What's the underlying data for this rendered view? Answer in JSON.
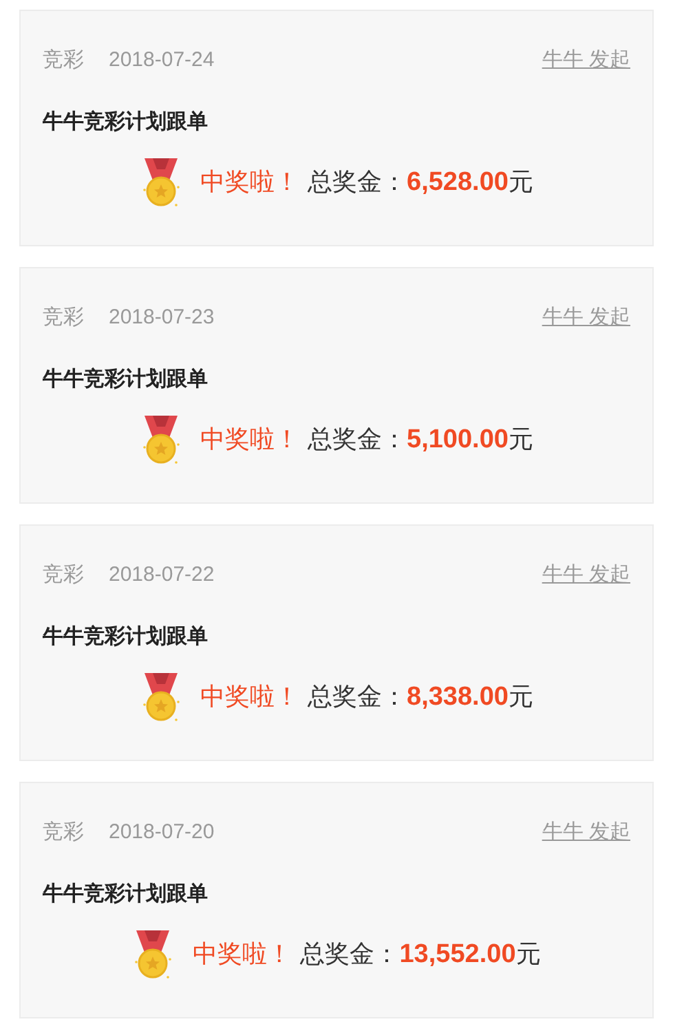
{
  "records": [
    {
      "category": "竞彩",
      "date": "2018-07-24",
      "initiator_link": "牛牛 发起",
      "title": "牛牛竞彩计划跟单",
      "win_label": "中奖啦！",
      "total_label": "总奖金：",
      "amount": "6,528.00",
      "unit": "元"
    },
    {
      "category": "竞彩",
      "date": "2018-07-23",
      "initiator_link": "牛牛 发起",
      "title": "牛牛竞彩计划跟单",
      "win_label": "中奖啦！",
      "total_label": "总奖金：",
      "amount": "5,100.00",
      "unit": "元"
    },
    {
      "category": "竞彩",
      "date": "2018-07-22",
      "initiator_link": "牛牛 发起",
      "title": "牛牛竞彩计划跟单",
      "win_label": "中奖啦！",
      "total_label": "总奖金：",
      "amount": "8,338.00",
      "unit": "元"
    },
    {
      "category": "竞彩",
      "date": "2018-07-20",
      "initiator_link": "牛牛 发起",
      "title": "牛牛竞彩计划跟单",
      "win_label": "中奖啦！",
      "total_label": "总奖金：",
      "amount": "13,552.00",
      "unit": "元"
    }
  ]
}
